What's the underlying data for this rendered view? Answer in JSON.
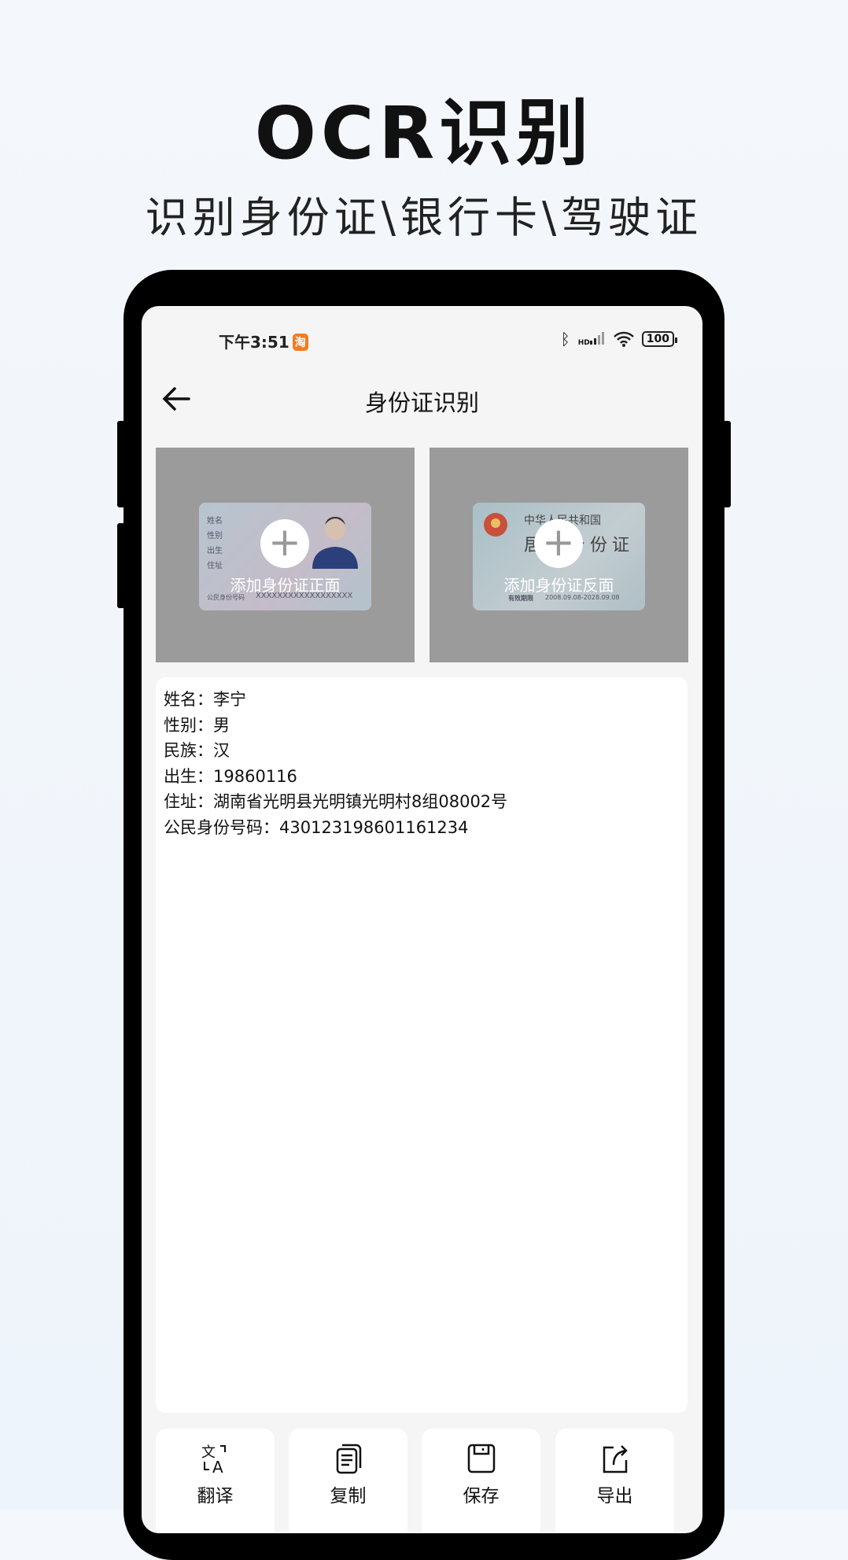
{
  "hero": {
    "title": "OCR识别",
    "subtitle": "识别身份证\\银行卡\\驾驶证"
  },
  "status": {
    "time": "下午3:51",
    "app_badge": "淘",
    "network": "HD",
    "battery": "100"
  },
  "nav": {
    "title": "身份证识别",
    "back_icon": "arrow-left-icon"
  },
  "cards": [
    {
      "label": "添加身份证正面",
      "sample_number": "XXXXXXXXXXXXXXXXXX",
      "sample_lines": [
        "姓名",
        "性别",
        "出生",
        "住址",
        "公民身份号码"
      ]
    },
    {
      "label": "添加身份证反面",
      "sample_country": "中华人民共和国",
      "sample_title": "居民身份证",
      "sample_validity_label": "有效期限",
      "sample_validity": "2008.09.08-2028.09.08"
    }
  ],
  "result": {
    "lines": [
      "姓名：李宁",
      "性别：男",
      "民族：汉",
      "出生：19860116",
      "住址：湖南省光明县光明镇光明村8组08002号",
      "公民身份号码：430123198601161234"
    ]
  },
  "actions": [
    {
      "label": "翻译",
      "icon": "translate-icon"
    },
    {
      "label": "复制",
      "icon": "copy-icon"
    },
    {
      "label": "保存",
      "icon": "save-icon"
    },
    {
      "label": "导出",
      "icon": "export-icon"
    }
  ]
}
